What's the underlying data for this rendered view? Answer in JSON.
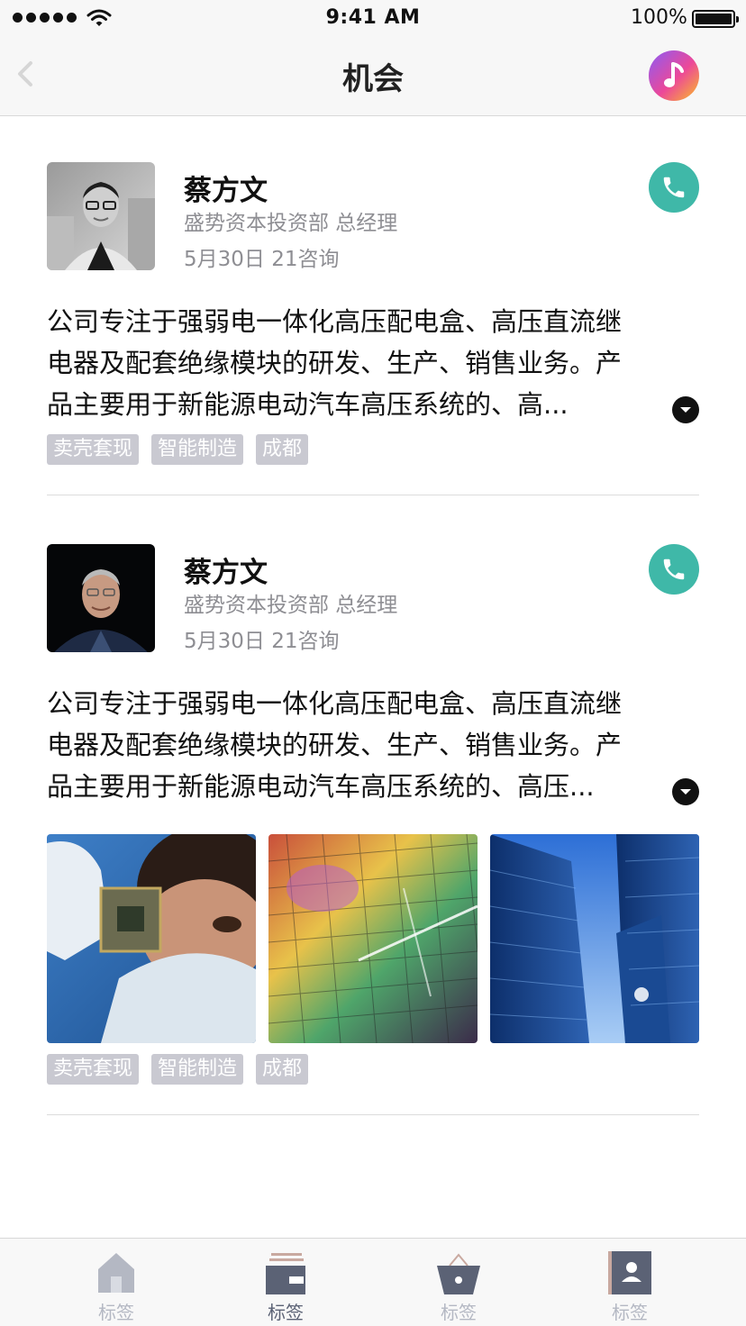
{
  "status_bar": {
    "time": "9:41 AM",
    "battery": "100%"
  },
  "nav": {
    "title": "机会",
    "back_icon": "chevron-left-icon",
    "action_icon": "music-note-icon"
  },
  "colors": {
    "call_button": "#3fb8a8",
    "tag_bg": "#c9c9d1",
    "tab_active": "#5b6275",
    "tab_inactive": "#b4b8c3"
  },
  "cards": [
    {
      "name": "蔡方文",
      "subtitle": "盛势资本投资部 总经理",
      "meta": "5月30日  21咨询",
      "description_lines": [
        "公司专注于强弱电一体化高压配电盒、高压直流继",
        "电器及配套绝缘模块的研发、生产、销售业务。产",
        "品主要用于新能源电动汽车高压系统的、高..."
      ],
      "tags": [
        "卖壳套现",
        "智能制造",
        "成都"
      ]
    },
    {
      "name": "蔡方文",
      "subtitle": "盛势资本投资部 总经理",
      "meta": "5月30日 21咨询",
      "description_lines": [
        "公司专注于强弱电一体化高压配电盒、高压直流继",
        "电器及配套绝缘模块的研发、生产、销售业务。产",
        "品主要用于新能源电动汽车高压系统的、高压..."
      ],
      "tags": [
        "卖壳套现",
        "智能制造",
        "成都"
      ]
    }
  ],
  "tabs": [
    {
      "label": "标签",
      "icon": "home-icon",
      "active": false
    },
    {
      "label": "标签",
      "icon": "wallet-icon",
      "active": true
    },
    {
      "label": "标签",
      "icon": "basket-icon",
      "active": false
    },
    {
      "label": "标签",
      "icon": "contact-card-icon",
      "active": false
    }
  ]
}
